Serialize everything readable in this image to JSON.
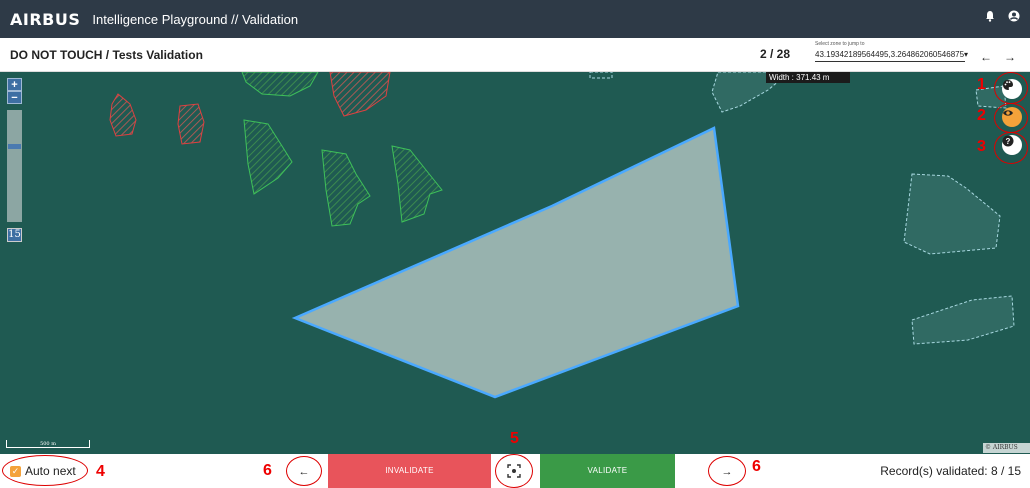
{
  "header": {
    "logo": "AIRBUS",
    "title": "Intelligence Playground // Validation",
    "icons": [
      "bell-icon",
      "account-icon"
    ]
  },
  "subheader": {
    "title": "DO NOT TOUCH / Tests Validation",
    "pager": "2 / 28",
    "zone_label": "Select zone to jump to",
    "zone_value": "43.19342189564495,3.264862060546875"
  },
  "map": {
    "width_readout": "Width : 371.43 m",
    "zoom_level": "15",
    "scale_label": "500 m",
    "attribution": "© AIRBUS",
    "tools": [
      "palette-icon",
      "eye-icon",
      "help-icon"
    ],
    "annotations": [
      "1",
      "2",
      "3",
      "4",
      "5",
      "6",
      "6"
    ]
  },
  "footer": {
    "auto_next_label": "Auto next",
    "auto_next_checked": true,
    "invalidate_label": "INVALIDATE",
    "validate_label": "VALIDATE",
    "records": "Record(s) validated: 8 / 15"
  },
  "colors": {
    "header_bg": "#2e3a47",
    "invalidate": "#e8545b",
    "validate": "#3a9a47",
    "accent": "#f4a23a",
    "annotation_red": "#e00000"
  }
}
